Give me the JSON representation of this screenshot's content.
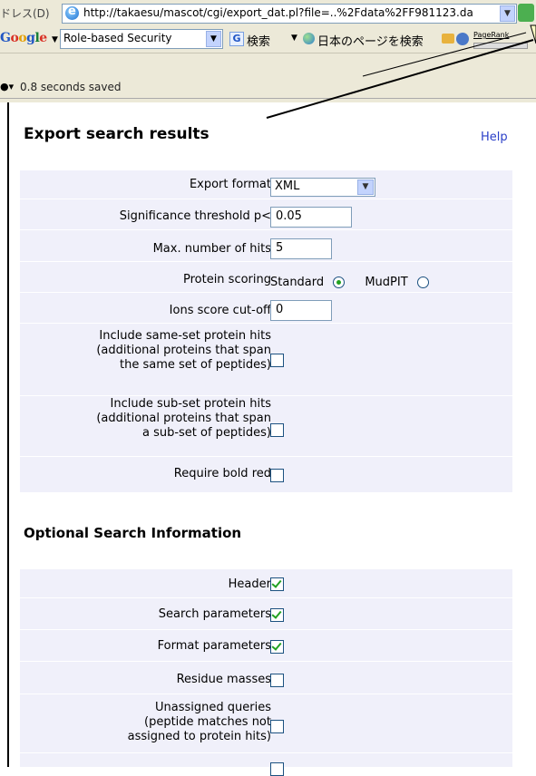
{
  "browser": {
    "address_label": "ドレス(D)",
    "url": "http://takaesu/mascot/cgi/export_dat.pl?file=..%2Fdata%2FF981123.da",
    "google_logo": "Google",
    "google_search_value": "Role-based Security",
    "google_search_button": "検索",
    "japanese_search_label": "日本のページを検索",
    "pagerank_label": "PageRank",
    "status_text": "0.8 seconds saved"
  },
  "page": {
    "title": "Export search results",
    "help_label": "Help"
  },
  "export": {
    "format_label": "Export format",
    "format_value": "XML",
    "threshold_label": "Significance threshold p<",
    "threshold_value": "0.05",
    "max_hits_label": "Max. number of hits",
    "max_hits_value": "5",
    "scoring_label": "Protein scoring",
    "scoring_standard": "Standard",
    "scoring_mudpit": "MudPIT",
    "scoring_selected": "Standard",
    "ions_cutoff_label": "Ions score cut-off",
    "ions_cutoff_value": "0",
    "same_set_label": [
      "Include same-set protein hits",
      "(additional proteins that span",
      "the same set of peptides)"
    ],
    "same_set_checked": false,
    "sub_set_label": [
      "Include sub-set protein hits",
      "(additional proteins that span",
      "a sub-set of peptides)"
    ],
    "sub_set_checked": false,
    "bold_red_label": "Require bold red",
    "bold_red_checked": false
  },
  "optional": {
    "title": "Optional Search Information",
    "header_label": "Header",
    "header_checked": true,
    "search_params_label": "Search parameters",
    "search_params_checked": true,
    "format_params_label": "Format parameters",
    "format_params_checked": true,
    "residue_masses_label": "Residue masses",
    "residue_masses_checked": false,
    "unassigned_label": [
      "Unassigned queries",
      "(peptide matches not",
      "assigned to protein hits)"
    ],
    "unassigned_checked": false
  }
}
